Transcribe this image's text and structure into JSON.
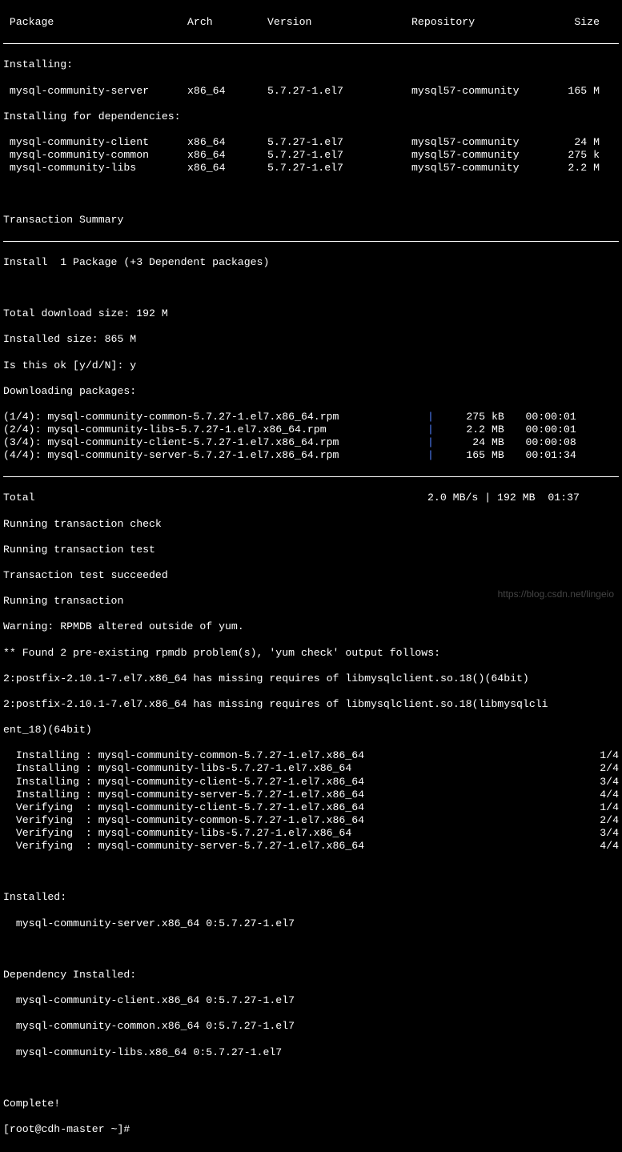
{
  "headers": {
    "package": " Package",
    "arch": "Arch",
    "version": "Version",
    "repository": "Repository",
    "size": "Size"
  },
  "sections": {
    "installing": "Installing:",
    "installing_deps": "Installing for dependencies:",
    "txn_summary": "Transaction Summary",
    "install_line": "Install  1 Package (+3 Dependent packages)",
    "total_dl": "Total download size: 192 M",
    "installed_size": "Installed size: 865 M",
    "confirm": "Is this ok [y/d/N]: y",
    "downloading": "Downloading packages:",
    "total": "Total",
    "total_stats": "2.0 MB/s | 192 MB  01:37",
    "run_check": "Running transaction check",
    "run_test": "Running transaction test",
    "test_ok": "Transaction test succeeded",
    "run_txn": "Running transaction",
    "warn_rpmdb": "Warning: RPMDB altered outside of yum.",
    "found_problems": "** Found 2 pre-existing rpmdb problem(s), 'yum check' output follows:",
    "problem1": "2:postfix-2.10.1-7.el7.x86_64 has missing requires of libmysqlclient.so.18()(64bit)",
    "problem2a": "2:postfix-2.10.1-7.el7.x86_64 has missing requires of libmysqlclient.so.18(libmysqlcli",
    "problem2b": "ent_18)(64bit)",
    "installed_hdr": "Installed:",
    "installed_pkg": "  mysql-community-server.x86_64 0:5.7.27-1.el7",
    "dep_installed_hdr": "Dependency Installed:",
    "dep1": "  mysql-community-client.x86_64 0:5.7.27-1.el7",
    "dep2": "  mysql-community-common.x86_64 0:5.7.27-1.el7",
    "dep3": "  mysql-community-libs.x86_64 0:5.7.27-1.el7",
    "complete": "Complete!",
    "prompt": "[root@cdh-master ~]#"
  },
  "install_table": [
    {
      "pkg": " mysql-community-server",
      "arch": "x86_64",
      "ver": "5.7.27-1.el7",
      "repo": "mysql57-community",
      "size": "165 M"
    }
  ],
  "deps_table": [
    {
      "pkg": " mysql-community-client",
      "arch": "x86_64",
      "ver": "5.7.27-1.el7",
      "repo": "mysql57-community",
      "size": " 24 M"
    },
    {
      "pkg": " mysql-community-common",
      "arch": "x86_64",
      "ver": "5.7.27-1.el7",
      "repo": "mysql57-community",
      "size": "275 k"
    },
    {
      "pkg": " mysql-community-libs",
      "arch": "x86_64",
      "ver": "5.7.27-1.el7",
      "repo": "mysql57-community",
      "size": "2.2 M"
    }
  ],
  "downloads": [
    {
      "name": "(1/4): mysql-community-common-5.7.27-1.el7.x86_64.rpm",
      "size": "275 kB",
      "time": "00:00:01"
    },
    {
      "name": "(2/4): mysql-community-libs-5.7.27-1.el7.x86_64.rpm",
      "size": "2.2 MB",
      "time": "00:00:01"
    },
    {
      "name": "(3/4): mysql-community-client-5.7.27-1.el7.x86_64.rpm",
      "size": " 24 MB",
      "time": "00:00:08"
    },
    {
      "name": "(4/4): mysql-community-server-5.7.27-1.el7.x86_64.rpm",
      "size": "165 MB",
      "time": "00:01:34"
    }
  ],
  "steps": [
    {
      "action": "Installing",
      "pkg": "mysql-community-common-5.7.27-1.el7.x86_64",
      "n": "1/4"
    },
    {
      "action": "Installing",
      "pkg": "mysql-community-libs-5.7.27-1.el7.x86_64",
      "n": "2/4"
    },
    {
      "action": "Installing",
      "pkg": "mysql-community-client-5.7.27-1.el7.x86_64",
      "n": "3/4"
    },
    {
      "action": "Installing",
      "pkg": "mysql-community-server-5.7.27-1.el7.x86_64",
      "n": "4/4"
    },
    {
      "action": "Verifying ",
      "pkg": "mysql-community-client-5.7.27-1.el7.x86_64",
      "n": "1/4"
    },
    {
      "action": "Verifying ",
      "pkg": "mysql-community-common-5.7.27-1.el7.x86_64",
      "n": "2/4"
    },
    {
      "action": "Verifying ",
      "pkg": "mysql-community-libs-5.7.27-1.el7.x86_64",
      "n": "3/4"
    },
    {
      "action": "Verifying ",
      "pkg": "mysql-community-server-5.7.27-1.el7.x86_64",
      "n": "4/4"
    }
  ],
  "watermark": "https://blog.csdn.net/lingeio"
}
